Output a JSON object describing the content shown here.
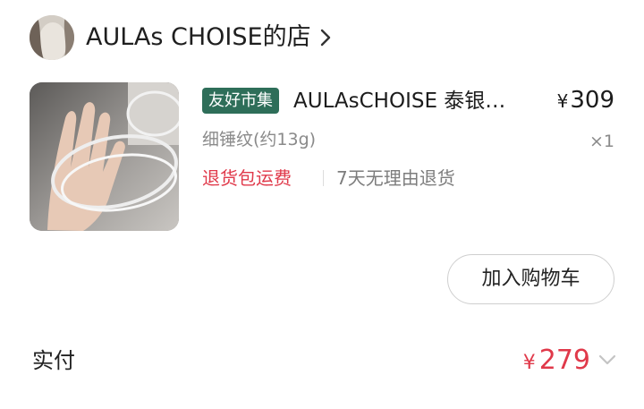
{
  "store": {
    "name": "AULAs CHOISE的店"
  },
  "item": {
    "badge": "友好市集",
    "title": "AULAsCHOISE 泰银…",
    "currency": "¥",
    "price": "309",
    "variant": "细锤纹(约13g)",
    "quantity": "×1",
    "tag_return_shipping": "退货包运费",
    "tag_no_reason_return": "7天无理由退货"
  },
  "actions": {
    "add_to_cart": "加入购物车"
  },
  "payment": {
    "label": "实付",
    "currency": "¥",
    "amount": "279"
  },
  "colors": {
    "accent_red": "#e0394a",
    "badge_green": "#2e6e59"
  },
  "icons": {
    "store_chevron": "chevron-right-icon",
    "payment_chevron": "chevron-down-icon"
  }
}
